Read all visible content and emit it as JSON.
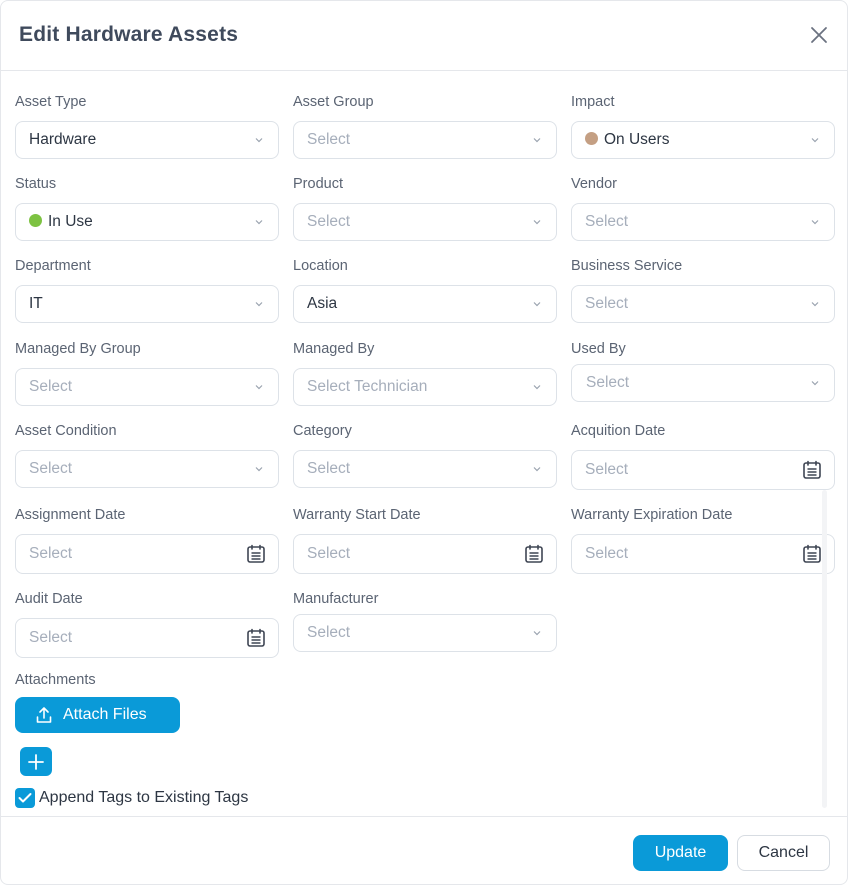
{
  "dialog": {
    "title": "Edit Hardware Assets",
    "close_label": "close"
  },
  "fields": {
    "asset_type": {
      "label": "Asset Type",
      "value": "Hardware"
    },
    "asset_group": {
      "label": "Asset Group",
      "placeholder": "Select"
    },
    "impact": {
      "label": "Impact",
      "value": "On Users",
      "dot_color": "#c49f83"
    },
    "status": {
      "label": "Status",
      "value": "In Use",
      "dot_color": "#7dc242"
    },
    "product": {
      "label": "Product",
      "placeholder": "Select"
    },
    "vendor": {
      "label": "Vendor",
      "placeholder": "Select"
    },
    "department": {
      "label": "Department",
      "value": "IT"
    },
    "location": {
      "label": "Location",
      "value": "Asia"
    },
    "business_service": {
      "label": "Business Service",
      "placeholder": "Select"
    },
    "managed_by_group": {
      "label": "Managed By Group",
      "placeholder": "Select"
    },
    "managed_by": {
      "label": "Managed By",
      "placeholder": "Select Technician"
    },
    "used_by": {
      "label": "Used By",
      "placeholder": "Select"
    },
    "asset_condition": {
      "label": "Asset Condition",
      "placeholder": "Select"
    },
    "category": {
      "label": "Category",
      "placeholder": "Select"
    },
    "acquisition_date": {
      "label": "Acquition Date",
      "placeholder": "Select"
    },
    "assignment_date": {
      "label": "Assignment Date",
      "placeholder": "Select"
    },
    "warranty_start_date": {
      "label": "Warranty Start Date",
      "placeholder": "Select"
    },
    "warranty_expiration_date": {
      "label": "Warranty Expiration Date",
      "placeholder": "Select"
    },
    "audit_date": {
      "label": "Audit Date",
      "placeholder": "Select"
    },
    "manufacturer": {
      "label": "Manufacturer",
      "placeholder": "Select"
    }
  },
  "attachments": {
    "label": "Attachments",
    "button_label": "Attach Files"
  },
  "tags": {
    "append_label": "Append Tags to Existing Tags",
    "append_checked": true
  },
  "footer": {
    "update_label": "Update",
    "cancel_label": "Cancel"
  },
  "colors": {
    "primary": "#0a9ad8"
  }
}
